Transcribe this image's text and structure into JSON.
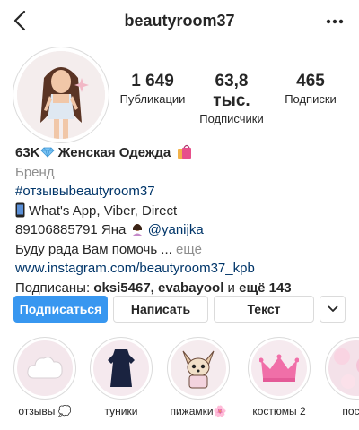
{
  "header": {
    "username": "beautyroom37"
  },
  "stats": [
    {
      "value": "1 649",
      "label": "Публикации"
    },
    {
      "value": "63,8 тыс.",
      "label": "Подписчики"
    },
    {
      "value": "465",
      "label": "Подписки"
    }
  ],
  "bio": {
    "name_prefix": "63K",
    "name_text": " Женская Одежда",
    "category": "Бренд",
    "hashtag": "#отзывыbeautyroom37",
    "contact_line": "What's App, Viber, Direct",
    "phone_text": "89106885791 Яна",
    "mention": "@yanijka_",
    "help_text": "Буду рада Вам помочь ...",
    "more_link": "ещё",
    "website": "www.instagram.com/beautyroom37_kpb",
    "followed_by_prefix": "Подписаны: ",
    "followed_by_users": "oksi5467, evabayool",
    "followed_by_and": " и ",
    "followed_by_more": "ещё 143"
  },
  "buttons": {
    "follow": "Подписаться",
    "message": "Написать",
    "text": "Текст"
  },
  "highlights": [
    {
      "label": "отзывы 💭",
      "icon": "cloud-icon"
    },
    {
      "label": "туники",
      "icon": "dress-icon"
    },
    {
      "label": "пижамки🌸",
      "icon": "chihuahua-icon"
    },
    {
      "label": "костюмы 2",
      "icon": "crown-icon"
    },
    {
      "label": "посте",
      "icon": "pink-pattern"
    }
  ],
  "colors": {
    "accent": "#3897f0",
    "link": "#003569",
    "muted": "#8e8e8e",
    "border": "#dbdbdb"
  }
}
